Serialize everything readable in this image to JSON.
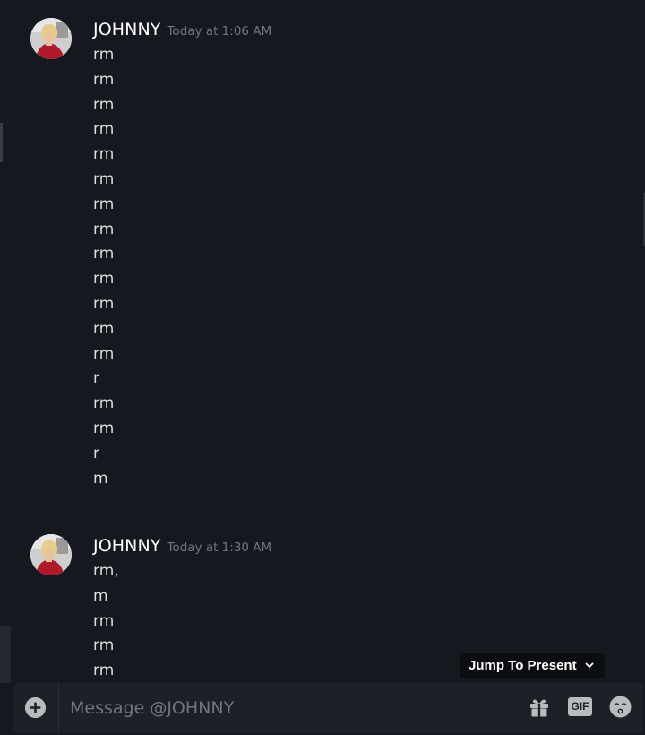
{
  "messages": [
    {
      "username": "JOHNNY",
      "timestamp": "Today at 1:06 AM",
      "lines": [
        "rm",
        "rm",
        "rm",
        "rm",
        "rm",
        "rm",
        "rm",
        "rm",
        "rm",
        "rm",
        "rm",
        "rm",
        "rm",
        "r",
        "rm",
        "rm",
        "r",
        "m"
      ]
    },
    {
      "username": "JOHNNY",
      "timestamp": "Today at 1:30 AM",
      "lines": [
        "rm,",
        "m",
        "rm",
        "rm",
        "rm"
      ]
    }
  ],
  "jump_to_present": {
    "label": "Jump To Present",
    "icon": "chevron-down-icon"
  },
  "composer": {
    "placeholder": "Message @JOHNNY",
    "value": "",
    "attach_icon": "plus-circle-icon",
    "gift_icon": "gift-icon",
    "gif_label": "GIF",
    "emoji_icon": "emoji-face-icon"
  },
  "colors": {
    "background": "#16181f",
    "composer_background": "#1d2027",
    "username": "#ffffff",
    "timestamp": "#72767d",
    "message_text": "#dcddde",
    "pill_background": "#0c0d10",
    "icon_gray": "#b9bbbe"
  }
}
